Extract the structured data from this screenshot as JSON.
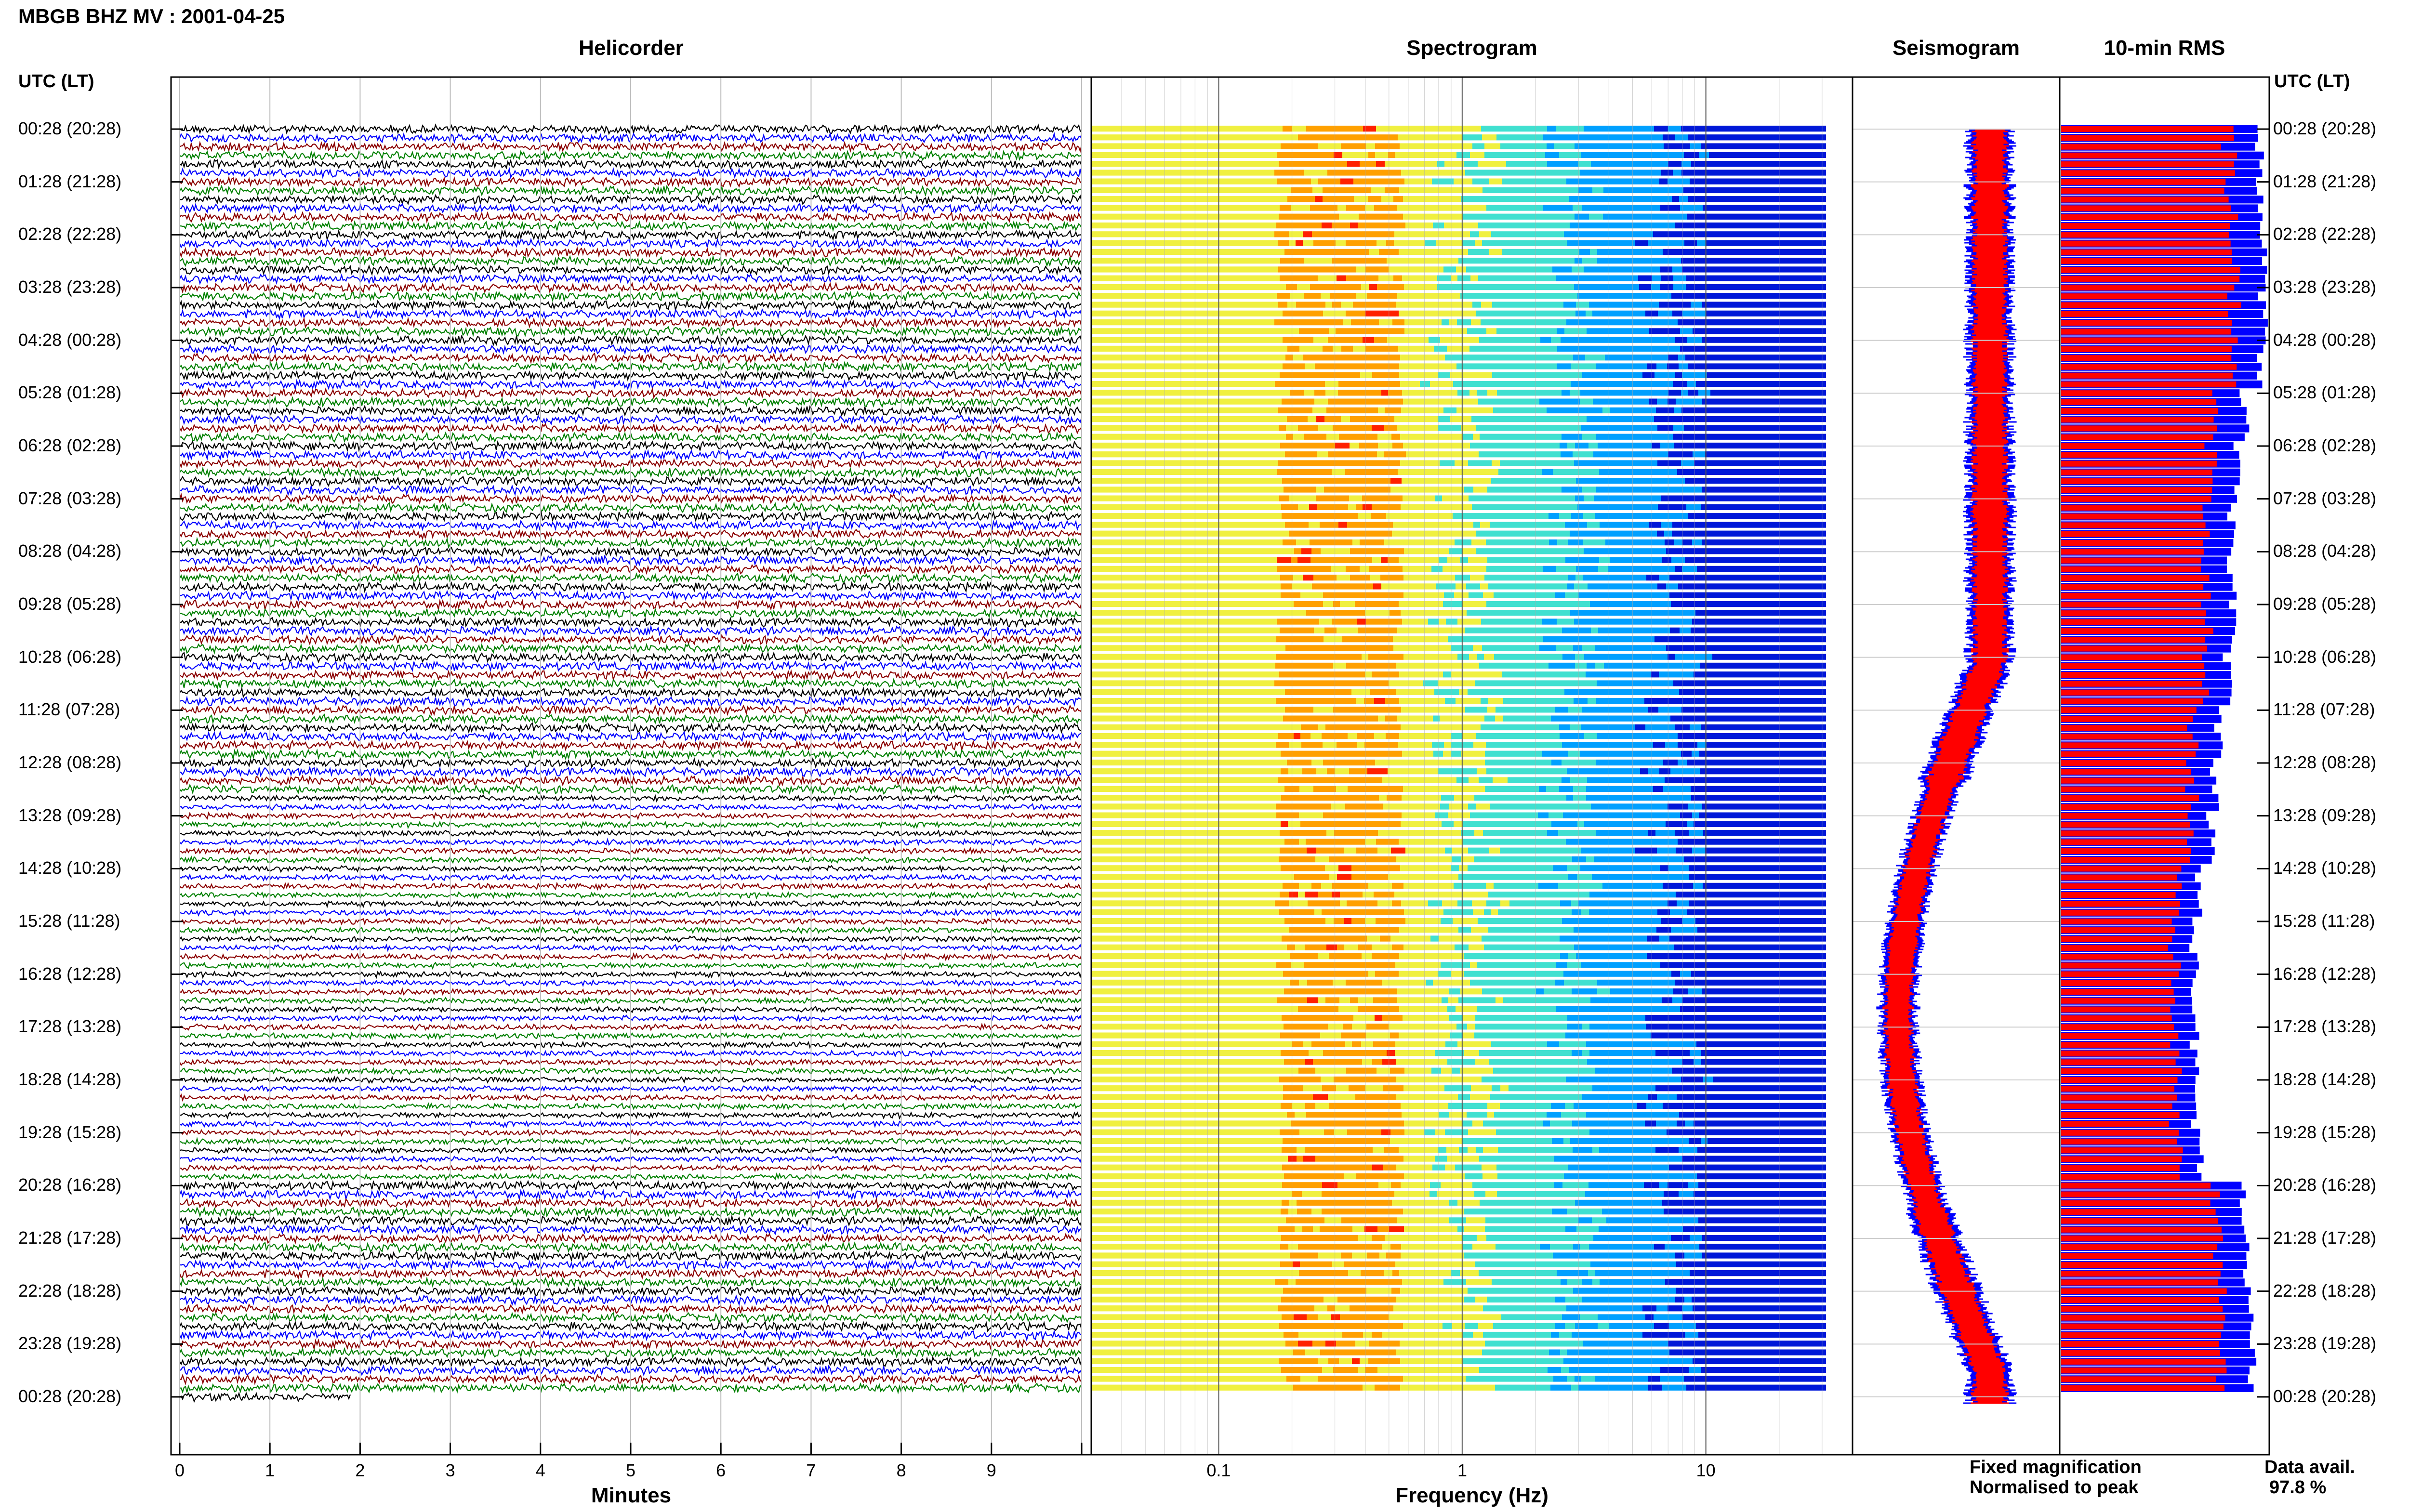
{
  "title": "MBGB BHZ MV : 2001-04-25",
  "utc_header": "UTC (LT)",
  "panels": {
    "helicorder": "Helicorder",
    "spectrogram": "Spectrogram",
    "seismogram": "Seismogram",
    "rms": "10-min RMS"
  },
  "time_labels": [
    "00:28 (20:28)",
    "01:28 (21:28)",
    "02:28 (22:28)",
    "03:28 (23:28)",
    "04:28 (00:28)",
    "05:28 (01:28)",
    "06:28 (02:28)",
    "07:28 (03:28)",
    "08:28 (04:28)",
    "09:28 (05:28)",
    "10:28 (06:28)",
    "11:28 (07:28)",
    "12:28 (08:28)",
    "13:28 (09:28)",
    "14:28 (10:28)",
    "15:28 (11:28)",
    "16:28 (12:28)",
    "17:28 (13:28)",
    "18:28 (14:28)",
    "19:28 (15:28)",
    "20:28 (16:28)",
    "21:28 (17:28)",
    "22:28 (18:28)",
    "23:28 (19:28)",
    "00:28 (20:28)"
  ],
  "helicorder_axis": {
    "label": "Minutes",
    "ticks": [
      "0",
      "1",
      "2",
      "3",
      "4",
      "5",
      "6",
      "7",
      "8",
      "9"
    ]
  },
  "spectrogram_axis": {
    "label": "Frequency (Hz)",
    "ticks": [
      "0.1",
      "1",
      "10"
    ],
    "scale": "log"
  },
  "legend": {
    "fixed": "Fixed magnification",
    "normalised": "Normalised to peak",
    "fixed_color": "#0000ff",
    "normalised_color": "#ff0000"
  },
  "data_avail": {
    "label": "Data avail.",
    "value": "97.8 %"
  },
  "colors": {
    "trace_cycle": [
      "#000000",
      "#0000ff",
      "#8b0000",
      "#008000"
    ],
    "spectro_scale": [
      "#0018d8",
      "#00a0ff",
      "#40e0d0",
      "#f0f040",
      "#ffa000",
      "#ff2000"
    ]
  },
  "chart_data": [
    {
      "type": "heatmap",
      "title": "Helicorder",
      "xlabel": "Minutes",
      "xlim": [
        0,
        10
      ],
      "rows_per_hour": 6,
      "rows": 145,
      "trace_colors": [
        "black",
        "blue",
        "darkred",
        "green"
      ]
    },
    {
      "type": "heatmap",
      "title": "Spectrogram",
      "xlabel": "Frequency (Hz)",
      "xscale": "log",
      "xlim": [
        0.03,
        40
      ],
      "dominant_band_hz": [
        0.2,
        0.5
      ]
    },
    {
      "type": "line",
      "title": "Seismogram",
      "series": [
        {
          "name": "Fixed magnification",
          "color": "blue"
        },
        {
          "name": "Normalised to peak",
          "color": "red"
        }
      ]
    },
    {
      "type": "bar",
      "title": "10-min RMS",
      "series": [
        {
          "name": "Fixed magnification",
          "color": "blue"
        },
        {
          "name": "Normalised to peak",
          "color": "red"
        }
      ],
      "fixed_profile_hourly": [
        0.95,
        0.96,
        0.97,
        0.97,
        0.96,
        0.88,
        0.84,
        0.82,
        0.82,
        0.82,
        0.8,
        0.76,
        0.74,
        0.72,
        0.66,
        0.64,
        0.64,
        0.64,
        0.64,
        0.67,
        0.87,
        0.89,
        0.9,
        0.92
      ]
    }
  ]
}
